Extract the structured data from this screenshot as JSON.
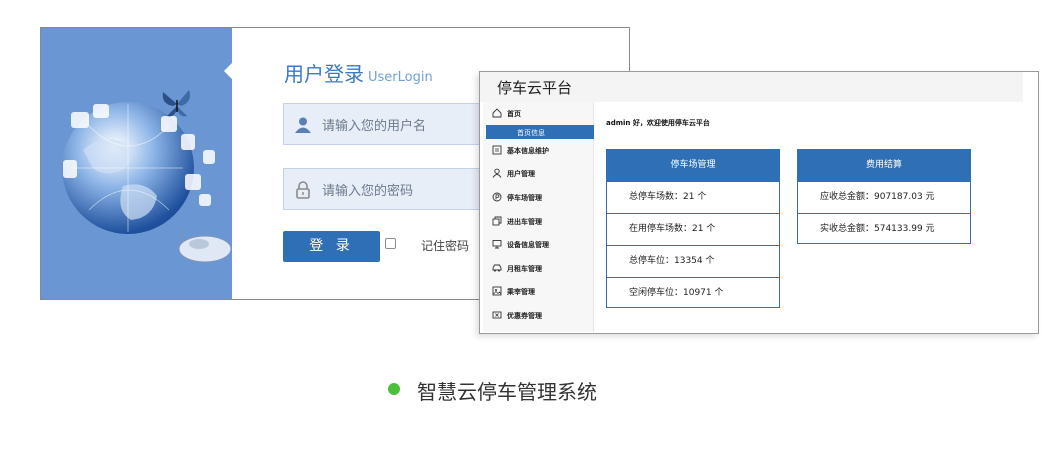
{
  "login": {
    "title": "用户登录",
    "title_sub": "UserLogin",
    "username_placeholder": "请输入您的用户名",
    "password_placeholder": "请输入您的密码",
    "login_button": "登 录",
    "remember_label": "记住密码",
    "remember_checked": false,
    "colors": {
      "side_panel": "#6a97d4",
      "accent": "#2e6fb5",
      "field_bg": "#e8eef8"
    }
  },
  "dashboard": {
    "title": "停车云平台",
    "sidebar": {
      "items": [
        {
          "label": "首页",
          "icon": "home-icon"
        },
        {
          "label": "基本信息维护",
          "icon": "document-icon"
        },
        {
          "label": "用户管理",
          "icon": "user-icon"
        },
        {
          "label": "停车场管理",
          "icon": "parking-icon"
        },
        {
          "label": "进出车管理",
          "icon": "copy-icon"
        },
        {
          "label": "设备信息管理",
          "icon": "monitor-icon"
        },
        {
          "label": "月租车管理",
          "icon": "car-icon"
        },
        {
          "label": "乘宰管理",
          "icon": "image-icon"
        },
        {
          "label": "优惠券管理",
          "icon": "coupon-icon"
        }
      ],
      "active_subitem": "首页信息"
    },
    "welcome": "admin 好，欢迎使用停车云平台",
    "parking_panel": {
      "title": "停车场管理",
      "rows": [
        "总停车场数：21 个",
        "在用停车场数：21 个",
        "总停车位：13354 个",
        "空闲停车位：10971 个"
      ]
    },
    "fees_panel": {
      "title": "费用结算",
      "rows": [
        "应收总金额：907187.03 元",
        "实收总金额：574133.99 元"
      ]
    }
  },
  "caption": {
    "text": "智慧云停车管理系统",
    "dot_color": "#4cbf3c"
  }
}
